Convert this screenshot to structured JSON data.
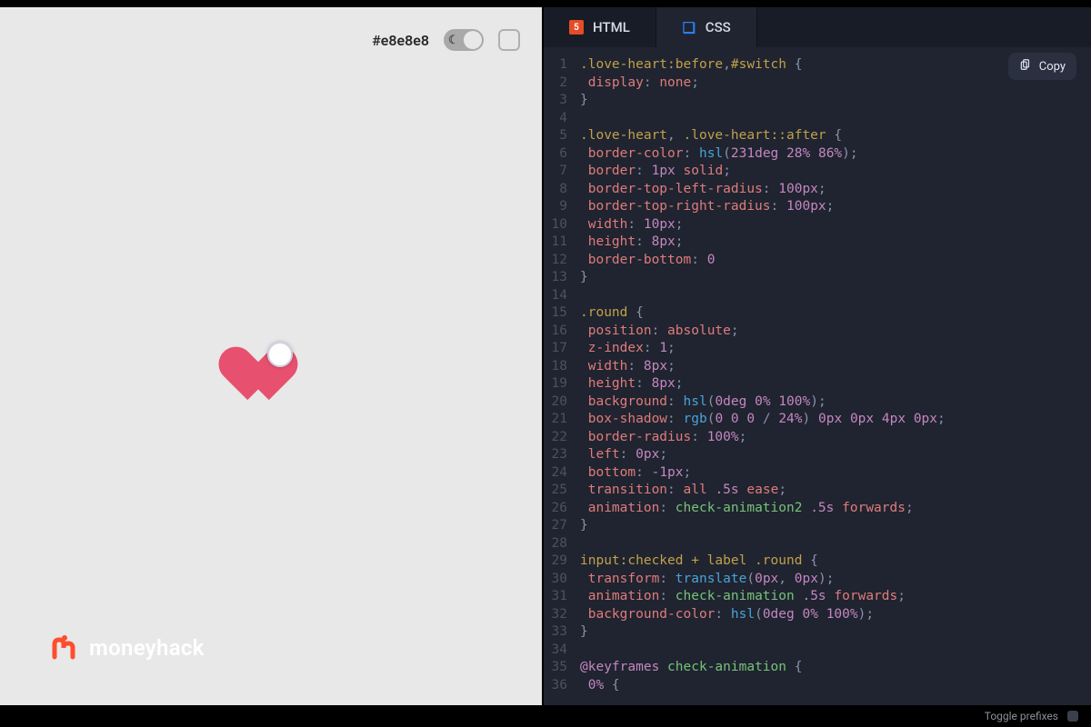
{
  "preview": {
    "bg_hex_label": "#e8e8e8",
    "brand_text": "moneyhack"
  },
  "tabs": {
    "html_label": "HTML",
    "css_label": "CSS"
  },
  "copy_label": "Copy",
  "statusbar": {
    "toggle_prefixes": "Toggle prefixes"
  },
  "code_lines": [
    [
      [
        "sel",
        ".love-heart:before"
      ],
      [
        "p",
        ","
      ],
      [
        "sel",
        "#switch"
      ],
      [
        "p",
        " {"
      ]
    ],
    [
      [
        "p",
        " "
      ],
      [
        "prop",
        "display"
      ],
      [
        "p",
        ": "
      ],
      [
        "val",
        "none"
      ],
      [
        "p",
        ";"
      ]
    ],
    [
      [
        "p",
        "}"
      ]
    ],
    [],
    [
      [
        "sel",
        ".love-heart"
      ],
      [
        "p",
        ", "
      ],
      [
        "sel",
        ".love-heart::after"
      ],
      [
        "p",
        " {"
      ]
    ],
    [
      [
        "p",
        " "
      ],
      [
        "prop",
        "border-color"
      ],
      [
        "p",
        ": "
      ],
      [
        "fn",
        "hsl"
      ],
      [
        "p",
        "("
      ],
      [
        "num",
        "231deg"
      ],
      [
        "p",
        " "
      ],
      [
        "num",
        "28%"
      ],
      [
        "p",
        " "
      ],
      [
        "num",
        "86%"
      ],
      [
        "p",
        ");"
      ]
    ],
    [
      [
        "p",
        " "
      ],
      [
        "prop",
        "border"
      ],
      [
        "p",
        ": "
      ],
      [
        "num",
        "1px"
      ],
      [
        "p",
        " "
      ],
      [
        "val",
        "solid"
      ],
      [
        "p",
        ";"
      ]
    ],
    [
      [
        "p",
        " "
      ],
      [
        "prop",
        "border-top-left-radius"
      ],
      [
        "p",
        ": "
      ],
      [
        "num",
        "100px"
      ],
      [
        "p",
        ";"
      ]
    ],
    [
      [
        "p",
        " "
      ],
      [
        "prop",
        "border-top-right-radius"
      ],
      [
        "p",
        ": "
      ],
      [
        "num",
        "100px"
      ],
      [
        "p",
        ";"
      ]
    ],
    [
      [
        "p",
        " "
      ],
      [
        "prop",
        "width"
      ],
      [
        "p",
        ": "
      ],
      [
        "num",
        "10px"
      ],
      [
        "p",
        ";"
      ]
    ],
    [
      [
        "p",
        " "
      ],
      [
        "prop",
        "height"
      ],
      [
        "p",
        ": "
      ],
      [
        "num",
        "8px"
      ],
      [
        "p",
        ";"
      ]
    ],
    [
      [
        "p",
        " "
      ],
      [
        "prop",
        "border-bottom"
      ],
      [
        "p",
        ": "
      ],
      [
        "num",
        "0"
      ]
    ],
    [
      [
        "p",
        "}"
      ]
    ],
    [],
    [
      [
        "sel",
        ".round"
      ],
      [
        "p",
        " {"
      ]
    ],
    [
      [
        "p",
        " "
      ],
      [
        "prop",
        "position"
      ],
      [
        "p",
        ": "
      ],
      [
        "val",
        "absolute"
      ],
      [
        "p",
        ";"
      ]
    ],
    [
      [
        "p",
        " "
      ],
      [
        "prop",
        "z-index"
      ],
      [
        "p",
        ": "
      ],
      [
        "num",
        "1"
      ],
      [
        "p",
        ";"
      ]
    ],
    [
      [
        "p",
        " "
      ],
      [
        "prop",
        "width"
      ],
      [
        "p",
        ": "
      ],
      [
        "num",
        "8px"
      ],
      [
        "p",
        ";"
      ]
    ],
    [
      [
        "p",
        " "
      ],
      [
        "prop",
        "height"
      ],
      [
        "p",
        ": "
      ],
      [
        "num",
        "8px"
      ],
      [
        "p",
        ";"
      ]
    ],
    [
      [
        "p",
        " "
      ],
      [
        "prop",
        "background"
      ],
      [
        "p",
        ": "
      ],
      [
        "fn",
        "hsl"
      ],
      [
        "p",
        "("
      ],
      [
        "num",
        "0deg"
      ],
      [
        "p",
        " "
      ],
      [
        "num",
        "0%"
      ],
      [
        "p",
        " "
      ],
      [
        "num",
        "100%"
      ],
      [
        "p",
        ");"
      ]
    ],
    [
      [
        "p",
        " "
      ],
      [
        "prop",
        "box-shadow"
      ],
      [
        "p",
        ": "
      ],
      [
        "fn",
        "rgb"
      ],
      [
        "p",
        "("
      ],
      [
        "num",
        "0"
      ],
      [
        "p",
        " "
      ],
      [
        "num",
        "0"
      ],
      [
        "p",
        " "
      ],
      [
        "num",
        "0"
      ],
      [
        "p",
        " / "
      ],
      [
        "num",
        "24%"
      ],
      [
        "p",
        ") "
      ],
      [
        "num",
        "0px"
      ],
      [
        "p",
        " "
      ],
      [
        "num",
        "0px"
      ],
      [
        "p",
        " "
      ],
      [
        "num",
        "4px"
      ],
      [
        "p",
        " "
      ],
      [
        "num",
        "0px"
      ],
      [
        "p",
        ";"
      ]
    ],
    [
      [
        "p",
        " "
      ],
      [
        "prop",
        "border-radius"
      ],
      [
        "p",
        ": "
      ],
      [
        "num",
        "100%"
      ],
      [
        "p",
        ";"
      ]
    ],
    [
      [
        "p",
        " "
      ],
      [
        "prop",
        "left"
      ],
      [
        "p",
        ": "
      ],
      [
        "num",
        "0px"
      ],
      [
        "p",
        ";"
      ]
    ],
    [
      [
        "p",
        " "
      ],
      [
        "prop",
        "bottom"
      ],
      [
        "p",
        ": "
      ],
      [
        "num",
        "-1px"
      ],
      [
        "p",
        ";"
      ]
    ],
    [
      [
        "p",
        " "
      ],
      [
        "prop",
        "transition"
      ],
      [
        "p",
        ": "
      ],
      [
        "val",
        "all"
      ],
      [
        "p",
        " "
      ],
      [
        "num",
        ".5s"
      ],
      [
        "p",
        " "
      ],
      [
        "val",
        "ease"
      ],
      [
        "p",
        ";"
      ]
    ],
    [
      [
        "p",
        " "
      ],
      [
        "prop",
        "animation"
      ],
      [
        "p",
        ": "
      ],
      [
        "str",
        "check-animation2"
      ],
      [
        "p",
        " "
      ],
      [
        "num",
        ".5s"
      ],
      [
        "p",
        " "
      ],
      [
        "val",
        "forwards"
      ],
      [
        "p",
        ";"
      ]
    ],
    [
      [
        "p",
        "}"
      ]
    ],
    [],
    [
      [
        "sel",
        "input:checked + label .round"
      ],
      [
        "p",
        " {"
      ]
    ],
    [
      [
        "p",
        " "
      ],
      [
        "prop",
        "transform"
      ],
      [
        "p",
        ": "
      ],
      [
        "fn",
        "translate"
      ],
      [
        "p",
        "("
      ],
      [
        "num",
        "0px"
      ],
      [
        "p",
        ", "
      ],
      [
        "num",
        "0px"
      ],
      [
        "p",
        ");"
      ]
    ],
    [
      [
        "p",
        " "
      ],
      [
        "prop",
        "animation"
      ],
      [
        "p",
        ": "
      ],
      [
        "str",
        "check-animation"
      ],
      [
        "p",
        " "
      ],
      [
        "num",
        ".5s"
      ],
      [
        "p",
        " "
      ],
      [
        "val",
        "forwards"
      ],
      [
        "p",
        ";"
      ]
    ],
    [
      [
        "p",
        " "
      ],
      [
        "prop",
        "background-color"
      ],
      [
        "p",
        ": "
      ],
      [
        "fn",
        "hsl"
      ],
      [
        "p",
        "("
      ],
      [
        "num",
        "0deg"
      ],
      [
        "p",
        " "
      ],
      [
        "num",
        "0%"
      ],
      [
        "p",
        " "
      ],
      [
        "num",
        "100%"
      ],
      [
        "p",
        ");"
      ]
    ],
    [
      [
        "p",
        "}"
      ]
    ],
    [],
    [
      [
        "kw",
        "@keyframes"
      ],
      [
        "p",
        " "
      ],
      [
        "str",
        "check-animation"
      ],
      [
        "p",
        " {"
      ]
    ],
    [
      [
        "p",
        " "
      ],
      [
        "num",
        "0%"
      ],
      [
        "p",
        " {"
      ]
    ]
  ]
}
